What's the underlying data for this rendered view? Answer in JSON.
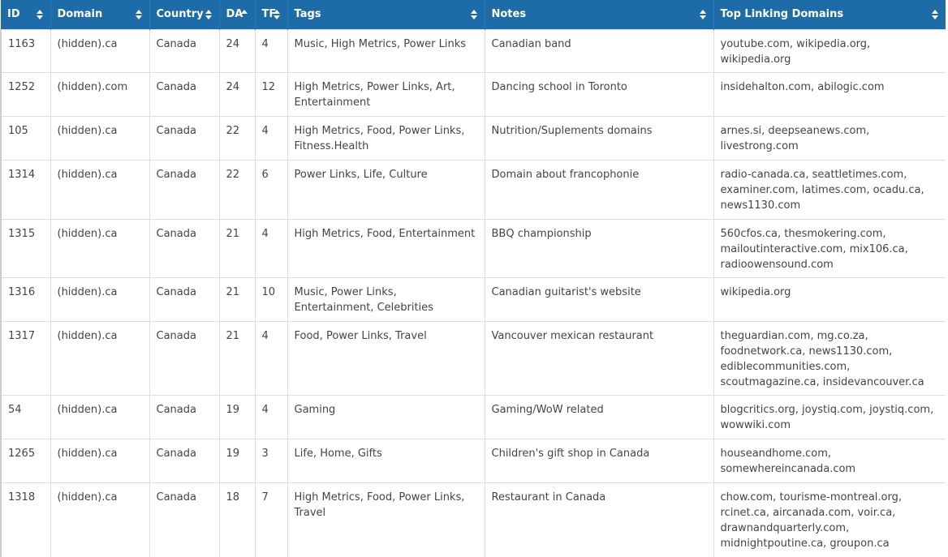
{
  "headers": {
    "id": "ID",
    "domain": "Domain",
    "country": "Country",
    "da": "DA",
    "tf": "TF",
    "tags": "Tags",
    "notes": "Notes",
    "top_linking": "Top Linking Domains"
  },
  "rows": [
    {
      "id": "1163",
      "domain": "(hidden).ca",
      "country": "Canada",
      "da": "24",
      "tf": "4",
      "tags": "Music, High Metrics, Power Links",
      "notes": "Canadian band",
      "top_linking": "youtube.com, wikipedia.org, wikipedia.org"
    },
    {
      "id": "1252",
      "domain": "(hidden).com",
      "country": "Canada",
      "da": "24",
      "tf": "12",
      "tags": "High Metrics, Power Links, Art, Entertainment",
      "notes": "Dancing school in Toronto",
      "top_linking": "insidehalton.com, abilogic.com"
    },
    {
      "id": "105",
      "domain": "(hidden).ca",
      "country": "Canada",
      "da": "22",
      "tf": "4",
      "tags": "High Metrics, Food, Power Links, Fitness.Health",
      "notes": "Nutrition/Suplements domains",
      "top_linking": "arnes.si, deepseanews.com, livestrong.com"
    },
    {
      "id": "1314",
      "domain": "(hidden).ca",
      "country": "Canada",
      "da": "22",
      "tf": "6",
      "tags": "Power Links, Life, Culture",
      "notes": "Domain about francophonie",
      "top_linking": "radio-canada.ca, seattletimes.com, examiner.com, latimes.com, ocadu.ca, news1130.com"
    },
    {
      "id": "1315",
      "domain": "(hidden).ca",
      "country": "Canada",
      "da": "21",
      "tf": "4",
      "tags": "High Metrics, Food, Entertainment",
      "notes": "BBQ championship",
      "top_linking": "560cfos.ca, thesmokering.com, mailoutinteractive.com, mix106.ca, radioowensound.com"
    },
    {
      "id": "1316",
      "domain": "(hidden).ca",
      "country": "Canada",
      "da": "21",
      "tf": "10",
      "tags": "Music, Power Links, Entertainment, Celebrities",
      "notes": "Canadian guitarist's website",
      "top_linking": "wikipedia.org"
    },
    {
      "id": "1317",
      "domain": "(hidden).ca",
      "country": "Canada",
      "da": "21",
      "tf": "4",
      "tags": "Food, Power Links, Travel",
      "notes": "Vancouver mexican restaurant",
      "top_linking": "theguardian.com, mg.co.za, foodnetwork.ca, news1130.com, ediblecommunities.com, scoutmagazine.ca, insidevancouver.ca"
    },
    {
      "id": "54",
      "domain": "(hidden).ca",
      "country": "Canada",
      "da": "19",
      "tf": "4",
      "tags": "Gaming",
      "notes": "Gaming/WoW related",
      "top_linking": "blogcritics.org, joystiq.com, joystiq.com, wowwiki.com"
    },
    {
      "id": "1265",
      "domain": "(hidden).ca",
      "country": "Canada",
      "da": "19",
      "tf": "3",
      "tags": "Life, Home, Gifts",
      "notes": "Children's gift shop in Canada",
      "top_linking": "houseandhome.com, somewhereincanada.com"
    },
    {
      "id": "1318",
      "domain": "(hidden).ca",
      "country": "Canada",
      "da": "18",
      "tf": "7",
      "tags": "High Metrics, Food, Power Links, Travel",
      "notes": "Restaurant in Canada",
      "top_linking": "chow.com, tourisme-montreal.org, rcinet.ca, aircanada.com, voir.ca, drawnandquarterly.com, midnightpoutine.ca, groupon.ca"
    }
  ],
  "sort": {
    "column": "da",
    "direction": "descending"
  },
  "colors": {
    "header_bg": "#1d6ca8",
    "header_text": "#ffffff",
    "cell_text": "#444444",
    "border": "#dddddd"
  }
}
